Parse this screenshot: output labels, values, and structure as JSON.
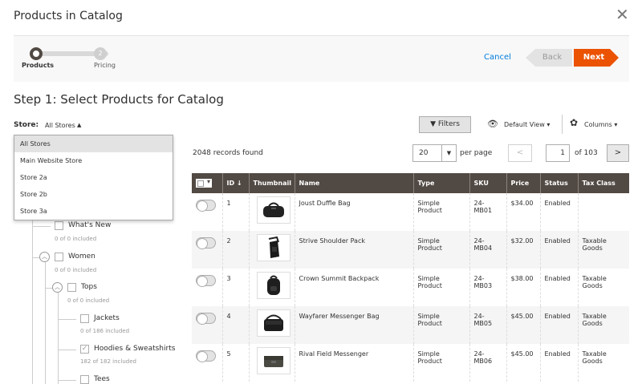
{
  "modal": {
    "title": "Products in Catalog",
    "close_icon": "close-icon"
  },
  "wizard": {
    "steps": [
      {
        "label": "Products",
        "number": "1"
      },
      {
        "label": "Pricing",
        "number": "2"
      }
    ],
    "cancel_label": "Cancel",
    "back_label": "Back",
    "next_label": "Next"
  },
  "step_heading": "Step 1: Select Products for Catalog",
  "store": {
    "label": "Store:",
    "value": "All Stores",
    "options": [
      "All Stores",
      "Main Website Store",
      "Store 2a",
      "Store 2b",
      "Store 3a"
    ]
  },
  "tree": [
    {
      "name": "What's New",
      "count": "0 of 0 included",
      "checked": false
    },
    {
      "name": "Women",
      "count": "0 of 0 included",
      "checked": false
    },
    {
      "name": "Tops",
      "count": "0 of 0 included",
      "checked": false
    },
    {
      "name": "Jackets",
      "count": "0 of 186 included",
      "checked": false
    },
    {
      "name": "Hoodies & Sweatshirts",
      "count": "182 of 182 included",
      "checked": true
    },
    {
      "name": "Tees",
      "count": "",
      "checked": false
    }
  ],
  "toolbar": {
    "filters_label": "Filters",
    "default_view_label": "Default View",
    "columns_label": "Columns"
  },
  "grid": {
    "records_found": "2048 records found",
    "per_page_value": "20",
    "per_page_label": "per page",
    "page_value": "1",
    "of_pages": "of 103",
    "columns": [
      "ID ↓",
      "Thumbnail",
      "Name",
      "Type",
      "SKU",
      "Price",
      "Status",
      "Tax Class"
    ],
    "rows": [
      {
        "id": "1",
        "name": "Joust Duffle Bag",
        "type": "Simple Product",
        "sku": "24-MB01",
        "price": "$34.00",
        "status": "Enabled",
        "tax": ""
      },
      {
        "id": "2",
        "name": "Strive Shoulder Pack",
        "type": "Simple Product",
        "sku": "24-MB04",
        "price": "$32.00",
        "status": "Enabled",
        "tax": "Taxable Goods"
      },
      {
        "id": "3",
        "name": "Crown Summit Backpack",
        "type": "Simple Product",
        "sku": "24-MB03",
        "price": "$38.00",
        "status": "Enabled",
        "tax": "Taxable Goods"
      },
      {
        "id": "4",
        "name": "Wayfarer Messenger Bag",
        "type": "Simple Product",
        "sku": "24-MB05",
        "price": "$45.00",
        "status": "Enabled",
        "tax": "Taxable Goods"
      },
      {
        "id": "5",
        "name": "Rival Field Messenger",
        "type": "Simple Product",
        "sku": "24-MB06",
        "price": "$45.00",
        "status": "Enabled",
        "tax": "Taxable Goods"
      }
    ]
  },
  "colors": {
    "accent": "#eb5202",
    "header_bg": "#514943",
    "link": "#007bdb"
  }
}
